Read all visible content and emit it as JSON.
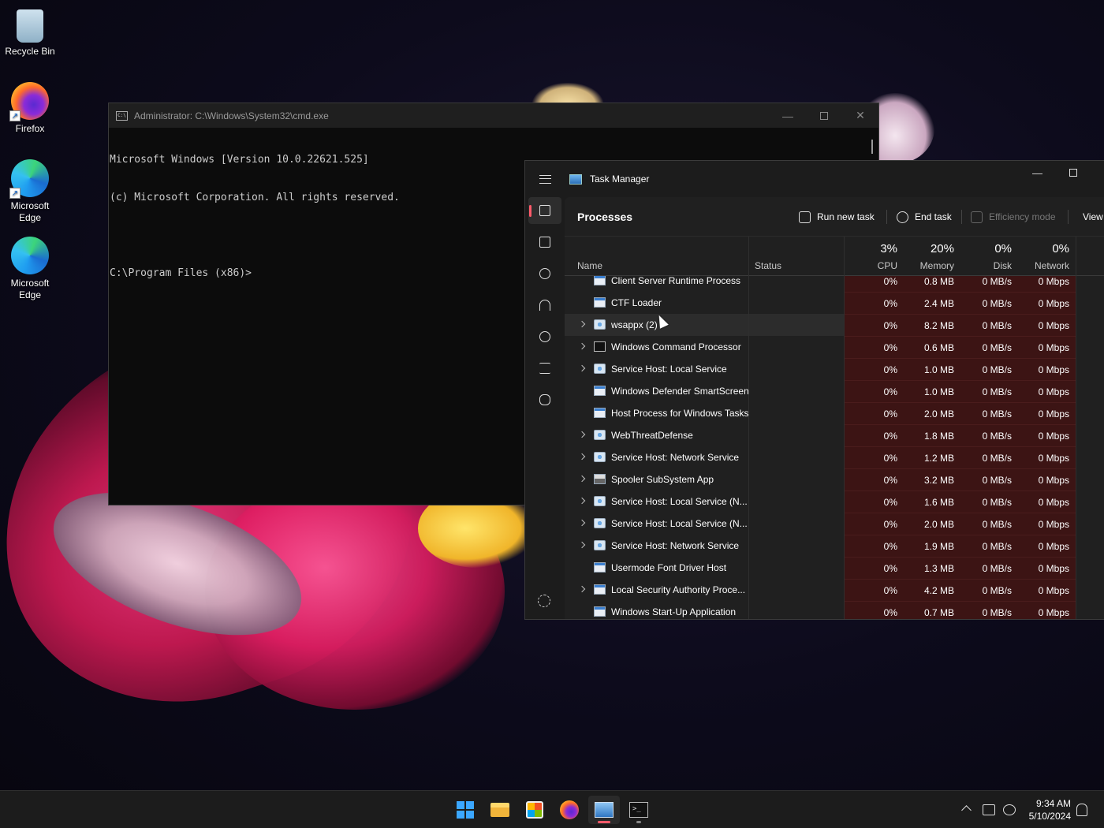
{
  "desktop": {
    "icons": [
      {
        "label": "Recycle Bin",
        "icon": "recycle-bin-icon"
      },
      {
        "label": "Firefox",
        "icon": "firefox-icon"
      },
      {
        "label": "Microsoft Edge",
        "icon": "edge-icon"
      },
      {
        "label": "Microsoft Edge",
        "icon": "edge-icon"
      }
    ]
  },
  "cmd": {
    "title": "Administrator: C:\\Windows\\System32\\cmd.exe",
    "lines": [
      "Microsoft Windows [Version 10.0.22621.525]",
      "(c) Microsoft Corporation. All rights reserved.",
      "",
      "C:\\Program Files (x86)>"
    ]
  },
  "taskmanager": {
    "title": "Task Manager",
    "heading": "Processes",
    "toolbar": {
      "run_new_task": "Run new task",
      "end_task": "End task",
      "efficiency_mode": "Efficiency mode",
      "view": "View"
    },
    "columns": {
      "name": "Name",
      "status": "Status",
      "cpu_pct": "3%",
      "cpu": "CPU",
      "memory_pct": "20%",
      "memory": "Memory",
      "disk_pct": "0%",
      "disk": "Disk",
      "network_pct": "0%",
      "network": "Network"
    },
    "rows": [
      {
        "name": "Client Server Runtime Process",
        "expandable": false,
        "icon": "app",
        "cpu": "0%",
        "memory": "0.8 MB",
        "disk": "0 MB/s",
        "network": "0 Mbps"
      },
      {
        "name": "CTF Loader",
        "expandable": false,
        "icon": "app",
        "cpu": "0%",
        "memory": "2.4 MB",
        "disk": "0 MB/s",
        "network": "0 Mbps"
      },
      {
        "name": "wsappx (2)",
        "expandable": true,
        "icon": "svc",
        "cpu": "0%",
        "memory": "8.2 MB",
        "disk": "0 MB/s",
        "network": "0 Mbps"
      },
      {
        "name": "Windows Command Processor",
        "expandable": true,
        "icon": "cmd",
        "cpu": "0%",
        "memory": "0.6 MB",
        "disk": "0 MB/s",
        "network": "0 Mbps"
      },
      {
        "name": "Service Host: Local Service",
        "expandable": true,
        "icon": "svc",
        "cpu": "0%",
        "memory": "1.0 MB",
        "disk": "0 MB/s",
        "network": "0 Mbps"
      },
      {
        "name": "Windows Defender SmartScreen",
        "expandable": false,
        "icon": "app",
        "cpu": "0%",
        "memory": "1.0 MB",
        "disk": "0 MB/s",
        "network": "0 Mbps"
      },
      {
        "name": "Host Process for Windows Tasks",
        "expandable": false,
        "icon": "app",
        "cpu": "0%",
        "memory": "2.0 MB",
        "disk": "0 MB/s",
        "network": "0 Mbps"
      },
      {
        "name": "WebThreatDefense",
        "expandable": true,
        "icon": "svc",
        "cpu": "0%",
        "memory": "1.8 MB",
        "disk": "0 MB/s",
        "network": "0 Mbps"
      },
      {
        "name": "Service Host: Network Service",
        "expandable": true,
        "icon": "svc",
        "cpu": "0%",
        "memory": "1.2 MB",
        "disk": "0 MB/s",
        "network": "0 Mbps"
      },
      {
        "name": "Spooler SubSystem App",
        "expandable": true,
        "icon": "print",
        "cpu": "0%",
        "memory": "3.2 MB",
        "disk": "0 MB/s",
        "network": "0 Mbps"
      },
      {
        "name": "Service Host: Local Service (N...",
        "expandable": true,
        "icon": "svc",
        "cpu": "0%",
        "memory": "1.6 MB",
        "disk": "0 MB/s",
        "network": "0 Mbps"
      },
      {
        "name": "Service Host: Local Service (N...",
        "expandable": true,
        "icon": "svc",
        "cpu": "0%",
        "memory": "2.0 MB",
        "disk": "0 MB/s",
        "network": "0 Mbps"
      },
      {
        "name": "Service Host: Network Service",
        "expandable": true,
        "icon": "svc",
        "cpu": "0%",
        "memory": "1.9 MB",
        "disk": "0 MB/s",
        "network": "0 Mbps"
      },
      {
        "name": "Usermode Font Driver Host",
        "expandable": false,
        "icon": "app",
        "cpu": "0%",
        "memory": "1.3 MB",
        "disk": "0 MB/s",
        "network": "0 Mbps"
      },
      {
        "name": "Local Security Authority Proce...",
        "expandable": true,
        "icon": "app",
        "cpu": "0%",
        "memory": "4.2 MB",
        "disk": "0 MB/s",
        "network": "0 Mbps"
      },
      {
        "name": "Windows Start-Up Application",
        "expandable": false,
        "icon": "app",
        "cpu": "0%",
        "memory": "0.7 MB",
        "disk": "0 MB/s",
        "network": "0 Mbps"
      }
    ]
  },
  "taskbar": {
    "time": "9:34 AM",
    "date": "5/10/2024"
  },
  "colors": {
    "accent": "#ff5a6a",
    "heat": "#3c1414"
  }
}
